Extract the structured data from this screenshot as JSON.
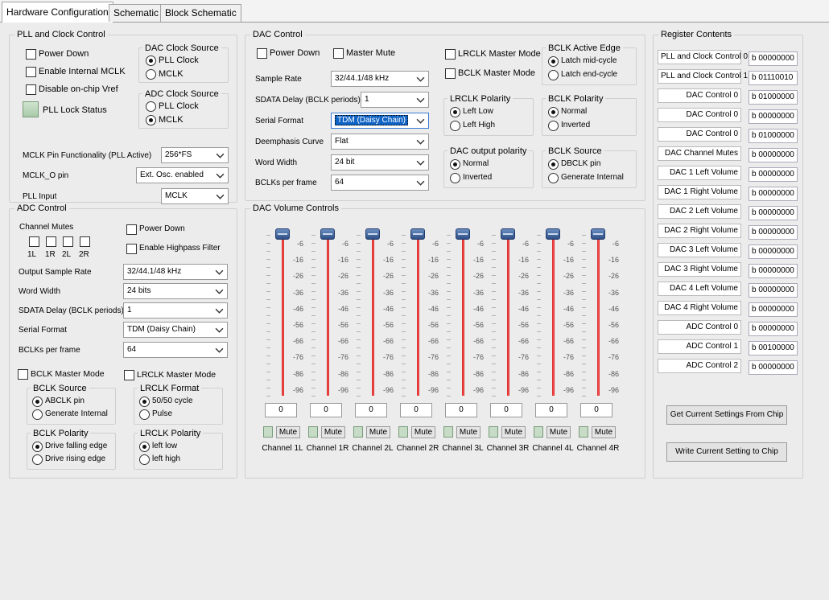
{
  "tabs": [
    "Hardware Configuration",
    "Schematic",
    "Block Schematic"
  ],
  "pll": {
    "title": "PLL and Clock Control",
    "power_down": "Power Down",
    "enable_internal_mclk": "Enable Internal MCLK",
    "disable_vref": "Disable on-chip Vref",
    "pll_lock_status": "PLL Lock Status",
    "dac_clock_source": {
      "title": "DAC Clock Source",
      "options": [
        "PLL Clock",
        "MCLK"
      ],
      "selected": 0
    },
    "adc_clock_source": {
      "title": "ADC Clock Source",
      "options": [
        "PLL Clock",
        "MCLK"
      ],
      "selected": 1
    },
    "mclk_pin_label": "MCLK Pin Functionality (PLL Active)",
    "mclk_pin_value": "256*FS",
    "mclk_o_label": "MCLK_O pin",
    "mclk_o_value": "Ext. Osc. enabled",
    "pll_input_label": "PLL Input",
    "pll_input_value": "MCLK"
  },
  "dac": {
    "title": "DAC Control",
    "power_down": "Power Down",
    "master_mute": "Master Mute",
    "lrclk_master": "LRCLK Master Mode",
    "bclk_master": "BCLK Master Mode",
    "rows": [
      {
        "label": "Sample Rate",
        "value": "32/44.1/48 kHz"
      },
      {
        "label": "SDATA Delay (BCLK periods)",
        "value": "1"
      },
      {
        "label": "Serial Format",
        "value": "TDM (Daisy Chain)"
      },
      {
        "label": "Deemphasis Curve",
        "value": "Flat"
      },
      {
        "label": "Word Width",
        "value": "24 bit"
      },
      {
        "label": "BCLKs per frame",
        "value": "64"
      }
    ],
    "bclk_active_edge": {
      "title": "BCLK Active Edge",
      "options": [
        "Latch mid-cycle",
        "Latch end-cycle"
      ],
      "selected": 0
    },
    "lrclk_polarity": {
      "title": "LRCLK Polarity",
      "options": [
        "Left Low",
        "Left High"
      ],
      "selected": 0
    },
    "bclk_polarity": {
      "title": "BCLK Polarity",
      "options": [
        "Normal",
        "Inverted"
      ],
      "selected": 0
    },
    "output_polarity": {
      "title": "DAC output polarity",
      "options": [
        "Normal",
        "Inverted"
      ],
      "selected": 0
    },
    "bclk_source": {
      "title": "BCLK Source",
      "options": [
        "DBCLK pin",
        "Generate Internal"
      ],
      "selected": 0
    }
  },
  "adc": {
    "title": "ADC Control",
    "channel_mutes": "Channel Mutes",
    "mute_channels": [
      "1L",
      "1R",
      "2L",
      "2R"
    ],
    "power_down": "Power Down",
    "highpass": "Enable Highpass Filter",
    "rows": [
      {
        "label": "Output Sample Rate",
        "value": "32/44.1/48 kHz"
      },
      {
        "label": "Word Width",
        "value": "24 bits"
      },
      {
        "label": "SDATA Delay (BCLK periods)",
        "value": "1"
      },
      {
        "label": "Serial Format",
        "value": "TDM (Daisy Chain)"
      },
      {
        "label": "BCLKs per frame",
        "value": "64"
      }
    ],
    "bclk_master": "BCLK Master Mode",
    "lrclk_master": "LRCLK Master Mode",
    "bclk_source": {
      "title": "BCLK Source",
      "options": [
        "ABCLK pin",
        "Generate Internal"
      ],
      "selected": 0
    },
    "lrclk_format": {
      "title": "LRCLK Format",
      "options": [
        "50/50 cycle",
        "Pulse"
      ],
      "selected": 0
    },
    "bclk_polarity": {
      "title": "BCLK Polarity",
      "options": [
        "Drive falling edge",
        "Drive rising edge"
      ],
      "selected": 0
    },
    "lrclk_polarity": {
      "title": "LRCLK Polarity",
      "options": [
        "left low",
        "left high"
      ],
      "selected": 0
    }
  },
  "volume": {
    "title": "DAC Volume Controls",
    "scale": [
      "-6",
      "-16",
      "-26",
      "-36",
      "-46",
      "-56",
      "-66",
      "-76",
      "-86",
      "-96"
    ],
    "mute_label": "Mute",
    "channels": [
      {
        "name": "Channel 1L",
        "value": "0"
      },
      {
        "name": "Channel 1R",
        "value": "0"
      },
      {
        "name": "Channel 2L",
        "value": "0"
      },
      {
        "name": "Channel 2R",
        "value": "0"
      },
      {
        "name": "Channel 3L",
        "value": "0"
      },
      {
        "name": "Channel 3R",
        "value": "0"
      },
      {
        "name": "Channel 4L",
        "value": "0"
      },
      {
        "name": "Channel 4R",
        "value": "0"
      }
    ]
  },
  "registers": {
    "title": "Register Contents",
    "items": [
      {
        "name": "PLL and Clock Control 0",
        "value": "b 00000000"
      },
      {
        "name": "PLL and Clock Control 1",
        "value": "b 01110010"
      },
      {
        "name": "DAC Control 0",
        "value": "b 01000000"
      },
      {
        "name": "DAC Control 0",
        "value": "b 00000000"
      },
      {
        "name": "DAC Control 0",
        "value": "b 01000000"
      },
      {
        "name": "DAC Channel Mutes",
        "value": "b 00000000"
      },
      {
        "name": "DAC 1 Left Volume",
        "value": "b 00000000"
      },
      {
        "name": "DAC 1 Right Volume",
        "value": "b 00000000"
      },
      {
        "name": "DAC 2 Left Volume",
        "value": "b 00000000"
      },
      {
        "name": "DAC 2 Right Volume",
        "value": "b 00000000"
      },
      {
        "name": "DAC 3 Left Volume",
        "value": "b 00000000"
      },
      {
        "name": "DAC 3 Right Volume",
        "value": "b 00000000"
      },
      {
        "name": "DAC 4 Left Volume",
        "value": "b 00000000"
      },
      {
        "name": "DAC 4 Right Volume",
        "value": "b 00000000"
      },
      {
        "name": "ADC Control 0",
        "value": "b 00000000"
      },
      {
        "name": "ADC Control 1",
        "value": "b 00100000"
      },
      {
        "name": "ADC Control 2",
        "value": "b 00000000"
      }
    ],
    "get_button": "Get Current Settings From Chip",
    "write_button": "Write Current Setting to Chip"
  }
}
